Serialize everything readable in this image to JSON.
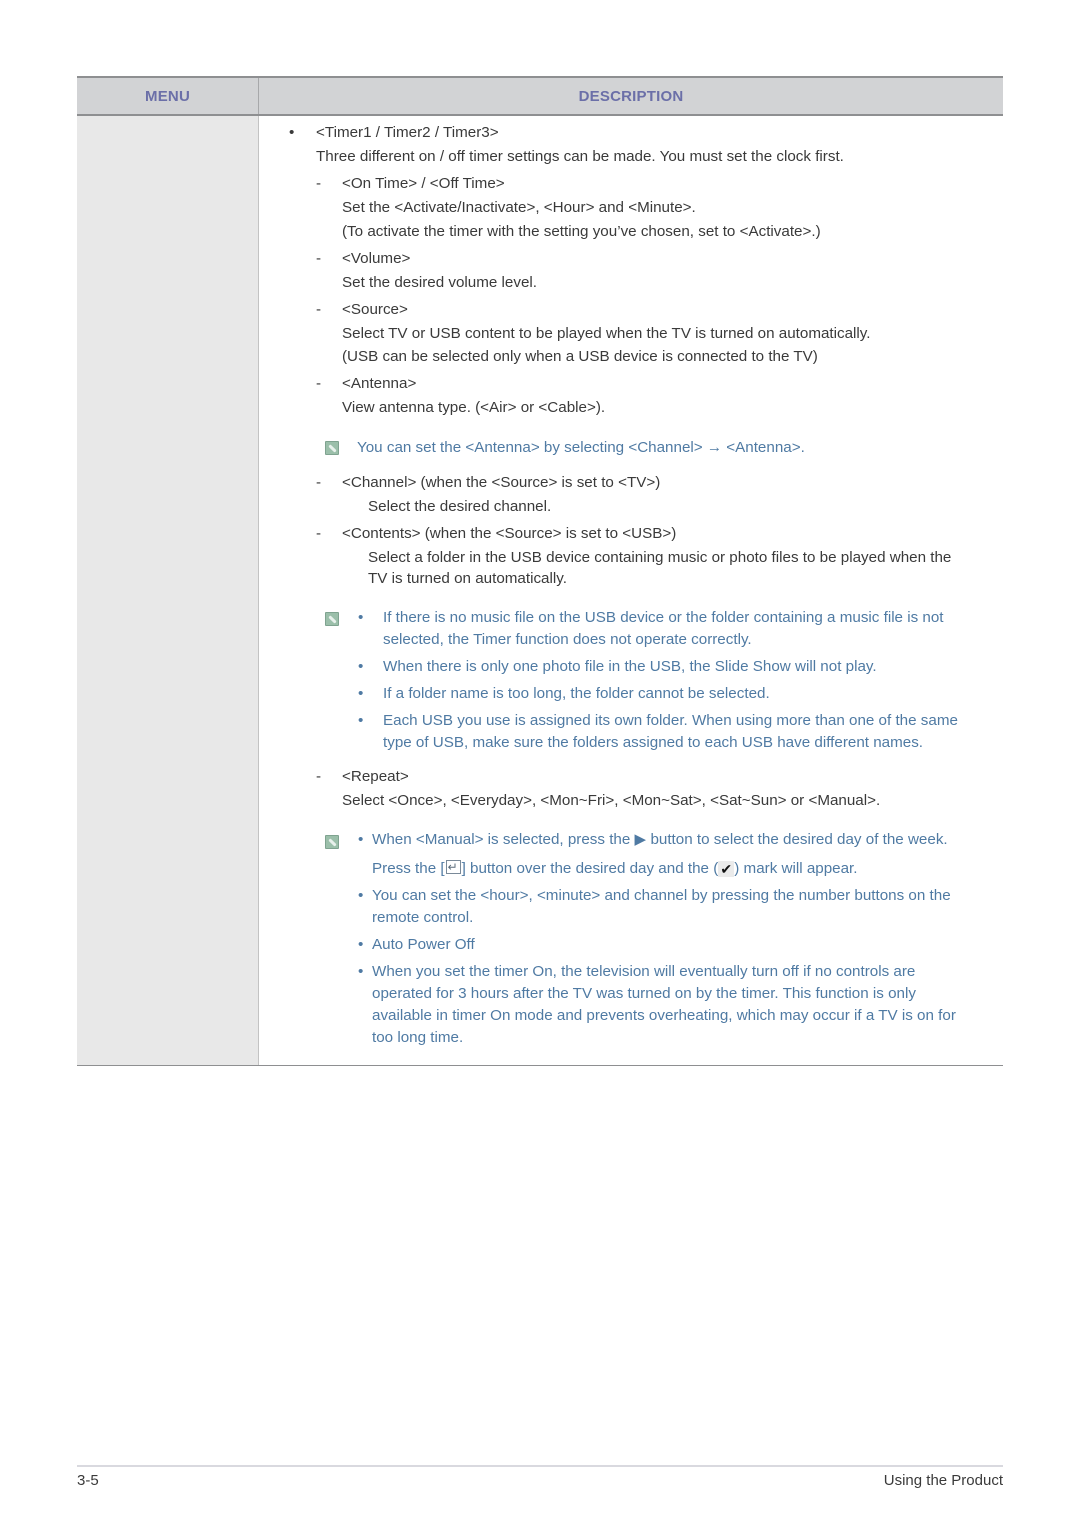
{
  "table": {
    "header": {
      "menu": "MENU",
      "description": "DESCRIPTION"
    }
  },
  "content": {
    "timers": {
      "bullet": "•",
      "title": "<Timer1 / Timer2 / Timer3>",
      "desc": "Three different on / off timer settings can be made. You must set the clock first."
    },
    "on_off_time": {
      "dash": "-",
      "title": "<On Time> / <Off Time>",
      "line1": "Set the <Activate/Inactivate>, <Hour> and <Minute>.",
      "line2": "(To activate the timer with the setting you’ve chosen, set to <Activate>.)"
    },
    "volume": {
      "dash": "-",
      "title": "<Volume>",
      "line1": "Set the desired volume level."
    },
    "source": {
      "dash": "-",
      "title": "<Source>",
      "line1": " Select TV or USB content to be played when the TV is turned on automatically.",
      "line2": "(USB can be selected only when a USB device is connected to the TV)"
    },
    "antenna": {
      "dash": "-",
      "title": "<Antenna>",
      "line1": "View antenna type. (<Air> or <Cable>)."
    },
    "antenna_note": "You can set the <Antenna> by selecting <Channel> → <Antenna>.",
    "channel": {
      "dash": "-",
      "title": "<Channel> (when the <Source> is set to <TV>)",
      "line1": "Select the desired channel."
    },
    "contents": {
      "dash": "-",
      "title": "<Contents> (when the <Source> is set to <USB>)",
      "line1": "Select a folder in the USB device containing music or photo files to be played when the",
      "line2": "TV is turned on automatically."
    },
    "usb_notes": [
      {
        "bullet": "•",
        "lines": [
          "If there is no music file on the USB device or the folder containing a music file is not",
          "selected, the Timer function does not operate correctly."
        ]
      },
      {
        "bullet": "•",
        "lines": [
          "When there is only one photo file in the USB, the Slide Show will not play."
        ]
      },
      {
        "bullet": "•",
        "lines": [
          "If a folder name is too long, the folder cannot be selected."
        ]
      },
      {
        "bullet": "•",
        "lines": [
          "Each USB you use is assigned its own folder. When using more than one of the same",
          "type of USB, make sure the folders assigned to each USB have different names."
        ]
      }
    ],
    "repeat": {
      "dash": "-",
      "title": "<Repeat>",
      "line1": "Select <Once>, <Everyday>, <Mon~Fri>, <Mon~Sat>, <Sat~Sun> or <Manual>."
    },
    "repeat_notes": {
      "manual": {
        "bullet": "•",
        "line1": "When <Manual> is selected, press the ▶ button to select the desired day of the week.",
        "line2_a": "Press the [",
        "line2_b": "] button over the desired day and the (",
        "line2_c": ") mark will appear.",
        "check_glyph": "✔"
      },
      "number_buttons": {
        "bullet": "•",
        "lines": [
          "You can set the <hour>, <minute> and channel by pressing the number buttons on the",
          "remote control."
        ]
      },
      "auto_power_off": {
        "bullet": "•",
        "lines": [
          "Auto Power Off"
        ]
      },
      "auto_power_desc": {
        "bullet": "•",
        "lines": [
          "When you set the timer On, the television will eventually turn off if no controls are",
          "operated for 3 hours after the TV was turned on by the timer. This function is only",
          "available in timer On mode and prevents overheating, which may occur if a TV is on for",
          "too long time."
        ]
      }
    }
  },
  "footer": {
    "page_number": "3-5",
    "section": "Using the Product"
  }
}
